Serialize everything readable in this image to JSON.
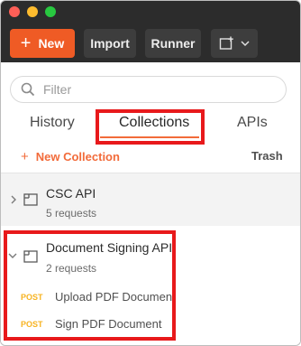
{
  "toolbar": {
    "new_label": "New",
    "import_label": "Import",
    "runner_label": "Runner"
  },
  "search": {
    "placeholder": "Filter",
    "value": ""
  },
  "tabs": [
    {
      "label": "History"
    },
    {
      "label": "Collections",
      "active": true
    },
    {
      "label": "APIs"
    }
  ],
  "actions": {
    "new_collection_label": "New Collection",
    "trash_label": "Trash"
  },
  "collections": [
    {
      "name": "CSC API",
      "count": "5 requests",
      "expanded": false
    },
    {
      "name": "Document Signing API",
      "count": "2 requests",
      "expanded": true,
      "requests": [
        {
          "method": "POST",
          "name": "Upload PDF Document"
        },
        {
          "method": "POST",
          "name": "Sign PDF Document"
        }
      ]
    }
  ],
  "colors": {
    "accent": "#f26b3a",
    "new_button": "#ef5b25",
    "titlebar": "#2c2c2c",
    "post_method": "#f7b321",
    "highlight": "#e8191b"
  },
  "icons": [
    "plus-icon",
    "new-window-icon",
    "chevron-down-icon",
    "search-icon",
    "chevron-right-icon",
    "folder-icon"
  ]
}
